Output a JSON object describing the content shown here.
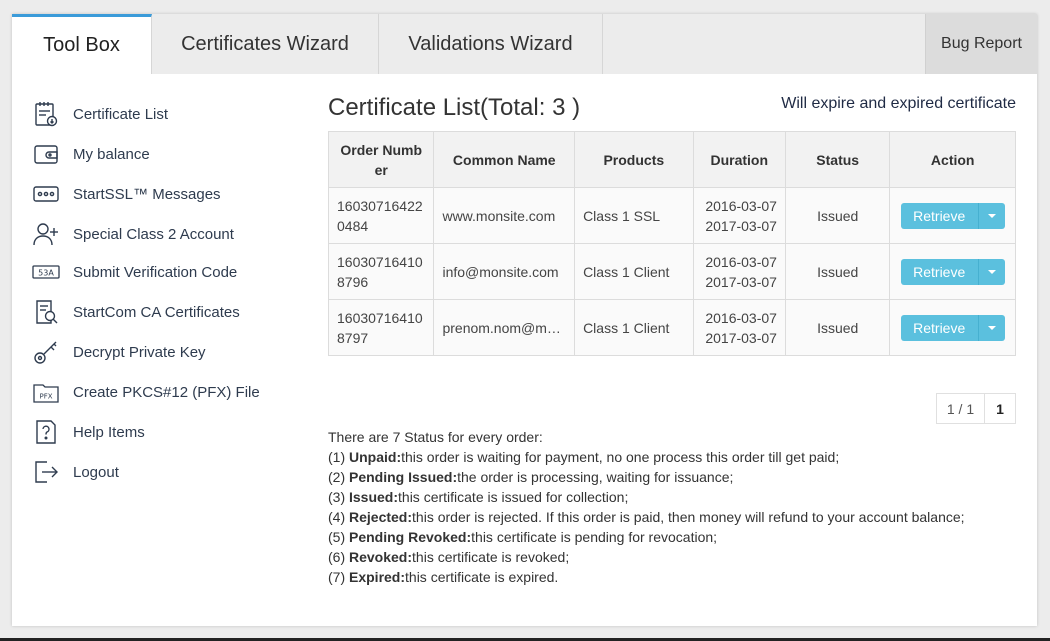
{
  "tabs": [
    {
      "label": "Tool Box",
      "active": true
    },
    {
      "label": "Certificates Wizard",
      "active": false
    },
    {
      "label": "Validations Wizard",
      "active": false
    }
  ],
  "bug_report": "Bug Report",
  "sidebar": {
    "items": [
      {
        "label": "Certificate List",
        "icon": "certificate-list-icon"
      },
      {
        "label": "My balance",
        "icon": "wallet-icon"
      },
      {
        "label": "StartSSL™ Messages",
        "icon": "message-icon"
      },
      {
        "label": "Special Class 2 Account",
        "icon": "add-user-icon"
      },
      {
        "label": "Submit Verification Code",
        "icon": "verification-code-icon"
      },
      {
        "label": "StartCom CA Certificates",
        "icon": "ca-certificate-icon"
      },
      {
        "label": "Decrypt Private Key",
        "icon": "key-icon"
      },
      {
        "label": "Create PKCS#12 (PFX) File",
        "icon": "pfx-folder-icon"
      },
      {
        "label": "Help Items",
        "icon": "help-icon"
      },
      {
        "label": "Logout",
        "icon": "logout-icon"
      }
    ]
  },
  "main": {
    "title": "Certificate List(Total: 3 )",
    "expire_link": "Will expire and expired certificate",
    "table": {
      "headers": [
        "Order Numb er",
        "Common Name",
        "Products",
        "Duration",
        "Status",
        "Action"
      ],
      "rows": [
        {
          "order1": "16030716422",
          "order2": "0484",
          "common_name": "www.monsite.com",
          "product": "Class 1 SSL",
          "start": "2016-03-07",
          "end": "2017-03-07",
          "status": "Issued",
          "action": "Retrieve"
        },
        {
          "order1": "16030716410",
          "order2": "8796",
          "common_name": "info@monsite.com",
          "product": "Class 1 Client",
          "start": "2016-03-07",
          "end": "2017-03-07",
          "status": "Issued",
          "action": "Retrieve"
        },
        {
          "order1": "16030716410",
          "order2": "8797",
          "common_name": "prenom.nom@mo...",
          "product": "Class 1 Client",
          "start": "2016-03-07",
          "end": "2017-03-07",
          "status": "Issued",
          "action": "Retrieve"
        }
      ]
    },
    "pagination": {
      "info": "1 / 1",
      "current": "1"
    },
    "notes": {
      "intro": "There are 7 Status for every order:",
      "items": [
        {
          "prefix": "(1) ",
          "term": "Unpaid:",
          "text": "this order is waiting for payment, no one process this order till get paid;"
        },
        {
          "prefix": "(2) ",
          "term": "Pending Issued:",
          "text": "the order is processing, waiting for issuance;"
        },
        {
          "prefix": "(3) ",
          "term": "Issued:",
          "text": "this certificate is issued for collection;"
        },
        {
          "prefix": "(4) ",
          "term": "Rejected:",
          "text": "this order is rejected. If this order is paid, then money will refund to your account balance;"
        },
        {
          "prefix": "(5) ",
          "term": "Pending Revoked:",
          "text": "this certificate is pending for revocation;"
        },
        {
          "prefix": "(6) ",
          "term": "Revoked:",
          "text": "this certificate is revoked;"
        },
        {
          "prefix": "(7) ",
          "term": "Expired:",
          "text": "this certificate is expired."
        }
      ]
    }
  },
  "colors": {
    "accent": "#3b9bd9",
    "button": "#5bc0de",
    "sidebar_text": "#2e3b4e"
  }
}
